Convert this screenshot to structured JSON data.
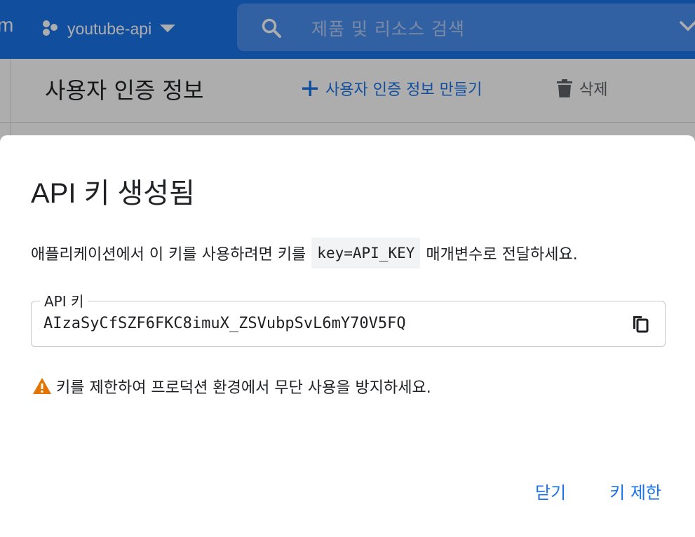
{
  "topbar": {
    "brand_fragment": "m",
    "project_name": "youtube-api",
    "search_placeholder": "제품 및 리소스 검색"
  },
  "page": {
    "title": "사용자 인증 정보",
    "create_label": "사용자 인증 정보 만들기",
    "delete_label": "삭제"
  },
  "dialog": {
    "title": "API 키 생성됨",
    "description_before": "애플리케이션에서 이 키를 사용하려면 키를",
    "description_code": "key=API_KEY",
    "description_after": "매개변수로 전달하세요.",
    "field_label": "API 키",
    "api_key": "AIzaSyCfSZF6FKC8imuX_ZSVubpSvL6mY70V5FQ",
    "warning": "키를 제한하여 프로덕션 환경에서 무단 사용을 방지하세요.",
    "close_label": "닫기",
    "restrict_label": "키 제한"
  },
  "colors": {
    "brand_blue": "#1a73e8",
    "warning_orange": "#e37400"
  }
}
